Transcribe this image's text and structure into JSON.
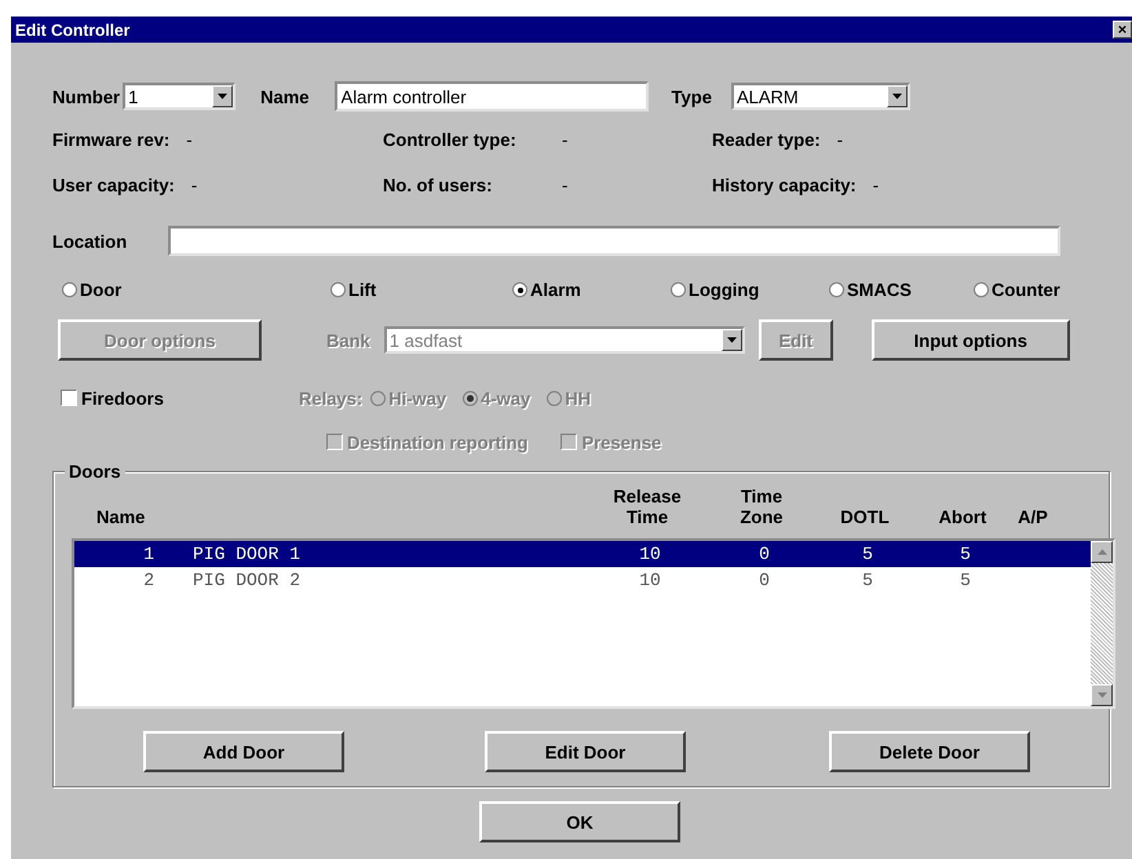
{
  "window": {
    "title": "Edit Controller",
    "close": "×"
  },
  "number": {
    "label": "Number",
    "value": "1"
  },
  "name": {
    "label": "Name",
    "value": "Alarm controller"
  },
  "type": {
    "label": "Type",
    "value": "ALARM"
  },
  "info": [
    {
      "label": "Firmware rev:",
      "value": "-"
    },
    {
      "label": "Controller type:",
      "value": "-"
    },
    {
      "label": "Reader type:",
      "value": "-"
    },
    {
      "label": "User capacity:",
      "value": "-"
    },
    {
      "label": "No. of users:",
      "value": "-"
    },
    {
      "label": "History capacity:",
      "value": "-"
    }
  ],
  "location": {
    "label": "Location"
  },
  "modes": [
    {
      "label": "Door",
      "selected": false
    },
    {
      "label": "Lift",
      "selected": false
    },
    {
      "label": "Alarm",
      "selected": true
    },
    {
      "label": "Logging",
      "selected": false
    },
    {
      "label": "SMACS",
      "selected": false
    },
    {
      "label": "Counter",
      "selected": false
    }
  ],
  "door_options": {
    "label": "Door options",
    "disabled": true
  },
  "bank": {
    "label": "Bank",
    "value": "1 asdfast",
    "disabled": true
  },
  "edit_button": {
    "label": "Edit",
    "disabled": true
  },
  "input_options": {
    "label": "Input options",
    "disabled": false
  },
  "firedoors": {
    "label": "Firedoors",
    "checked": false,
    "disabled": false
  },
  "relays": {
    "label": "Relays:",
    "disabled": true,
    "options": [
      {
        "label": "Hi-way",
        "selected": false
      },
      {
        "label": "4-way",
        "selected": true
      },
      {
        "label": "HH",
        "selected": false
      }
    ]
  },
  "destination_reporting": {
    "label": "Destination reporting",
    "checked": false,
    "disabled": true
  },
  "presense": {
    "label": "Presense",
    "checked": false,
    "disabled": true
  },
  "doors": {
    "title": "Doors",
    "columns": [
      "Name",
      "Release Time",
      "Time Zone",
      "DOTL",
      "Abort",
      "A/P"
    ],
    "rows": [
      {
        "number": "1",
        "name": "PIG DOOR 1",
        "release_time": "10",
        "time_zone": "0",
        "dotl": "5",
        "abort": "5",
        "selected": true
      },
      {
        "number": "2",
        "name": "PIG DOOR 2",
        "release_time": "10",
        "time_zone": "0",
        "dotl": "5",
        "abort": "5",
        "selected": false
      }
    ],
    "buttons": [
      "Add Door",
      "Edit Door",
      "Delete Door"
    ]
  },
  "ok": "OK"
}
